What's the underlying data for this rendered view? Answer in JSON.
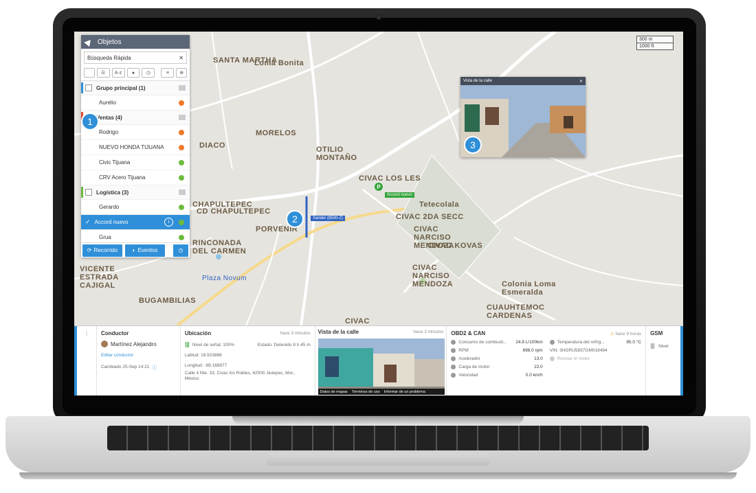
{
  "panel": {
    "title": "Objetos",
    "search_placeholder": "Búsqueda Rápida",
    "toolbar": {
      "sort_label": "A-z"
    },
    "groups": [
      {
        "name": "Grupo principal (1)",
        "color": "#2f8fd8",
        "items": [
          {
            "name": "Aurelio",
            "status_color": "#f07a2a"
          }
        ]
      },
      {
        "name": "Ventas (4)",
        "color": "#e04a3a",
        "items": [
          {
            "name": "Rodrigo",
            "status_color": "#f07a2a"
          },
          {
            "name": "NUEVO HONDA TIJUANA",
            "status_color": "#f07a2a"
          },
          {
            "name": "Civic Tijuana",
            "status_color": "#6dbb3c"
          },
          {
            "name": "CRV Acero Tijuana",
            "status_color": "#6dbb3c"
          }
        ]
      },
      {
        "name": "Logística (3)",
        "color": "#6dbb3c",
        "items": [
          {
            "name": "Gerardo",
            "status_color": "#6dbb3c"
          },
          {
            "name": "Accord nuevo",
            "status_color": "#6dbb3c",
            "selected": true
          },
          {
            "name": "Grua",
            "status_color": "#6dbb3c"
          }
        ]
      }
    ],
    "buttons": {
      "recorrido": "Recorrido",
      "eventos": "Eventos"
    }
  },
  "map": {
    "scale": [
      "300 m",
      "1000 ft"
    ],
    "labels": [
      "SANTA MARTHA",
      "Loma Bonita",
      "MORELOS",
      "OTILIO MONTAÑO",
      "CIVAC LOS LES",
      "Tetecolala",
      "CIVAC 2DA SECC",
      "CIVAC NARCISO MENDOZA",
      "CIVAC KOVAS",
      "CIVAC NARCISO MENDOZA",
      "CHAPULTEPEC",
      "CD CHAPULTEPEC",
      "PORVENIR",
      "RINCONADA DEL CARMEN",
      "VICENTE ESTRADA CAJIGAL",
      "BUGAMBILIAS",
      "Plaza Novum",
      "Colonia Loma Esmeralda",
      "CUAUHTEMOC CARDENAS",
      "CIVAC",
      "DIACO"
    ],
    "vehicle_label": "Xander (8500-Z)",
    "poi_letter": "P",
    "poi_tag": "Accord nuevo",
    "street_popup_title": "Vista de la calle"
  },
  "badges": [
    "1",
    "2",
    "3"
  ],
  "bottom": {
    "conductor": {
      "title": "Conductor",
      "name": "Martínez Alejandro",
      "edit": "Editar conductor",
      "changed": "Cambiado 25-Sep 14:21"
    },
    "ubicacion": {
      "title": "Ubicación",
      "ago": "hace 3 minutos",
      "signal": "Nivel de señal: 100%",
      "estado": "Estado: Detenido 8 h 45 m",
      "lat": "Latitud: 18.923886",
      "lon": "Longitud: -99.168977",
      "address": "Calle 4 Nte. 33, Civac los Robles, 62500 Jiutepec, Mor., México"
    },
    "vista": {
      "title": "Vista de la calle",
      "ago": "hace 3 minutos",
      "links": [
        "Datos de mapas",
        "Términos de uso",
        "Informar de un problema"
      ]
    },
    "obd": {
      "title": "OBD2 & CAN",
      "ago": "hace 9 horas",
      "rows": [
        {
          "k": "Consumo de combusti...",
          "v": "24.8 L/100km"
        },
        {
          "k": "RPM",
          "v": "698.0 rpm"
        },
        {
          "k": "Acelerador",
          "v": "13.0"
        },
        {
          "k": "Carga de motor",
          "v": "22.0"
        },
        {
          "k": "Velocidad",
          "v": "0.0 km/h"
        }
      ],
      "temp_label": "Temperatura del refrig...",
      "temp_value": "95.0 °C",
      "vin": "VIN: 3HGRU5837GM018494",
      "revisar": "Revisar el motor"
    },
    "gsm": {
      "title": "GSM",
      "nivel": "Nivel"
    }
  }
}
